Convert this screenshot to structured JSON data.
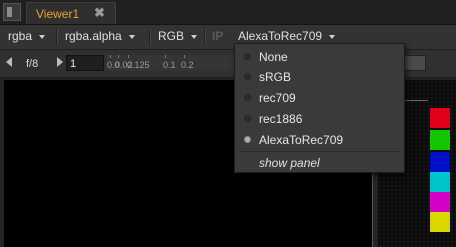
{
  "tabbar": {
    "tab_title": "Viewer1",
    "close_glyph": "✖"
  },
  "toolbar1": {
    "channels": "rgba",
    "alpha_channel": "rgba.alpha",
    "display_channels": "RGB",
    "ip_label": "IP",
    "viewer_process": "AlexaToRec709"
  },
  "toolbar2": {
    "fstop_label": "f/8",
    "gain_value": "1",
    "slider_ticks": [
      "0.0",
      "0.02",
      "0.125",
      "0.1",
      "0.2"
    ]
  },
  "menu": {
    "items": [
      {
        "label": "None",
        "selected": false
      },
      {
        "label": "sRGB",
        "selected": false
      },
      {
        "label": "rec709",
        "selected": false
      },
      {
        "label": "rec1886",
        "selected": false
      },
      {
        "label": "AlexaToRec709",
        "selected": true
      }
    ],
    "show_panel": "show panel"
  },
  "colors": {
    "accent": "#f0a030",
    "swatches": [
      "#e0001a",
      "#13c600",
      "#0010c8",
      "#00c4cc",
      "#d400c8",
      "#d8d800"
    ]
  }
}
